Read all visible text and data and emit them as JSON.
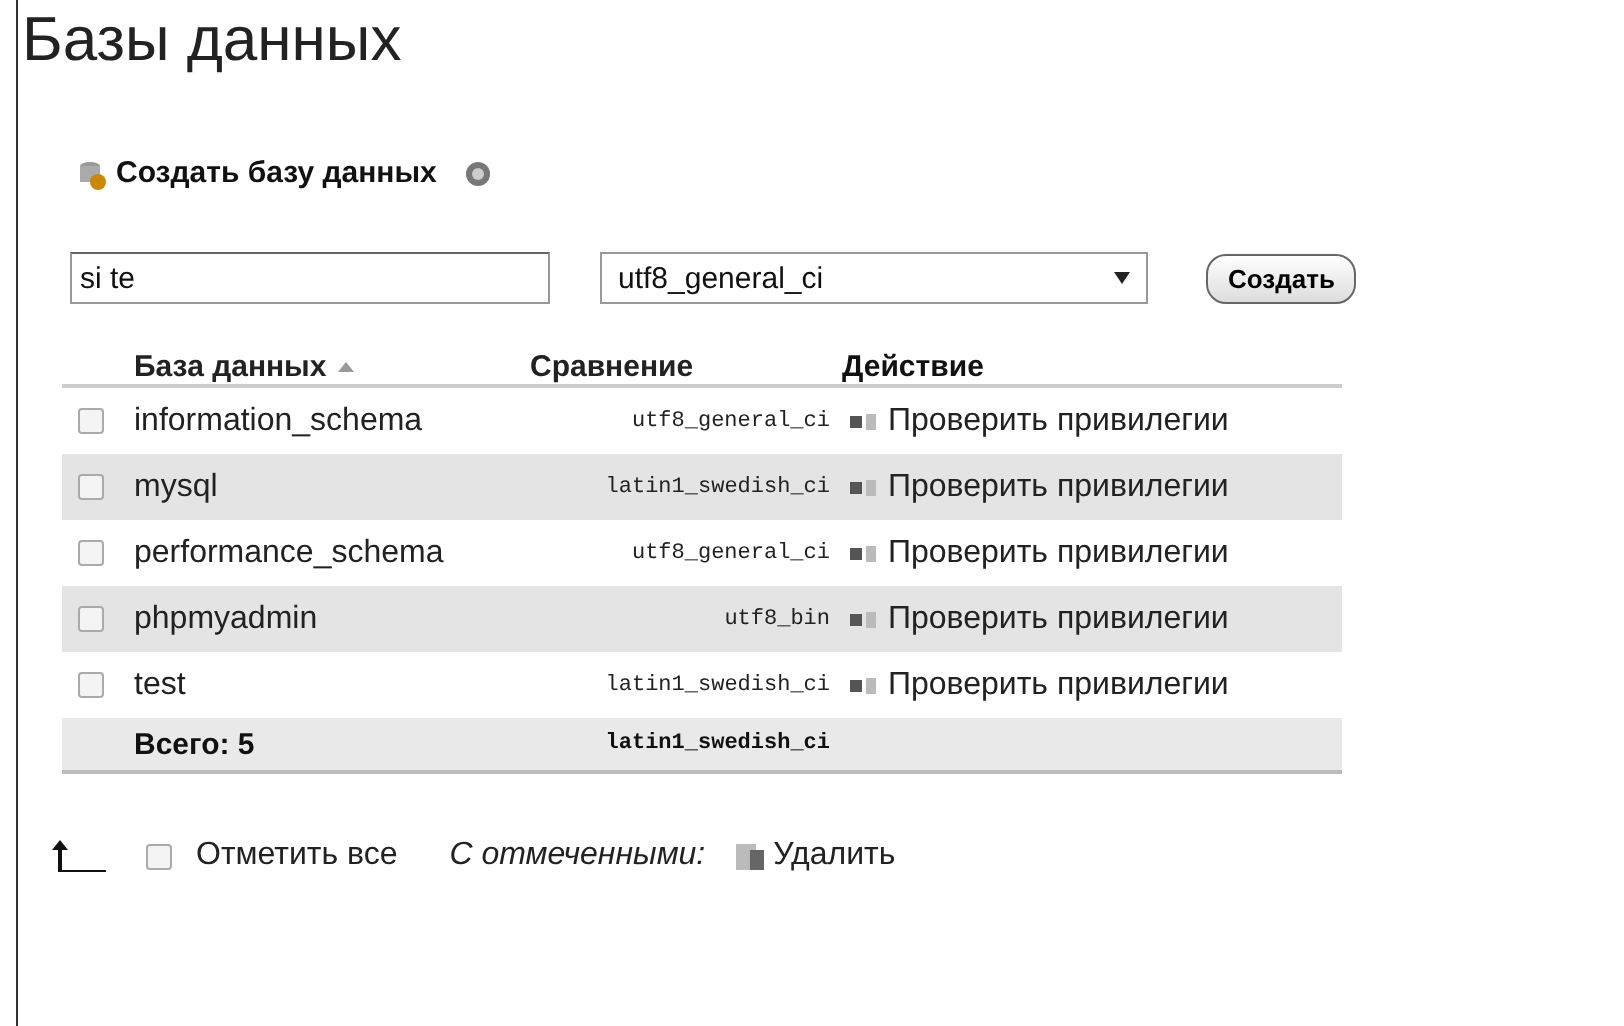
{
  "title": "Базы данных",
  "create": {
    "heading": "Создать базу данных",
    "name_value": "si te",
    "collation_value": "utf8_general_ci",
    "button": "Создать"
  },
  "table": {
    "columns": [
      "База данных",
      "Сравнение",
      "Действие"
    ],
    "rows": [
      {
        "name": "information_schema",
        "collation": "utf8_general_ci",
        "action": "Проверить привилегии",
        "checked": false
      },
      {
        "name": "mysql",
        "collation": "latin1_swedish_ci",
        "action": "Проверить привилегии",
        "checked": false
      },
      {
        "name": "performance_schema",
        "collation": "utf8_general_ci",
        "action": "Проверить привилегии",
        "checked": false
      },
      {
        "name": "phpmyadmin",
        "collation": "utf8_bin",
        "action": "Проверить привилегии",
        "checked": false
      },
      {
        "name": "test",
        "collation": "latin1_swedish_ci",
        "action": "Проверить привилегии",
        "checked": false
      }
    ],
    "total": {
      "label": "Всего: 5",
      "collation": "latin1_swedish_ci"
    }
  },
  "footer": {
    "check_all": "Отметить все",
    "check_all_checked": false,
    "with_selected": "С отмеченными:",
    "delete": "Удалить"
  }
}
